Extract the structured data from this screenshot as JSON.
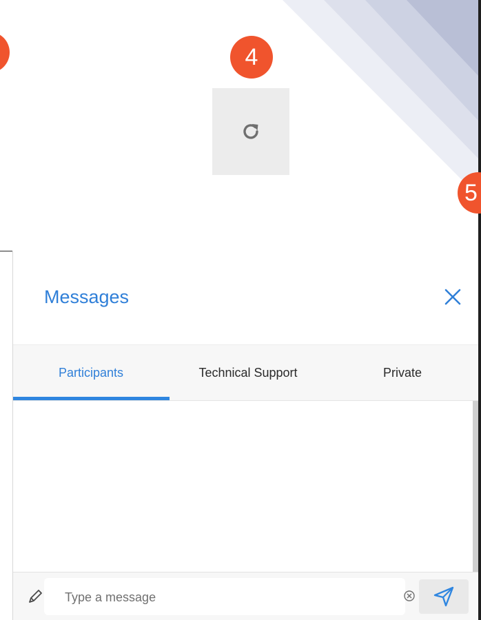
{
  "badges": {
    "left": "",
    "step4": "4",
    "step5": "5"
  },
  "icons": {
    "refresh": "refresh-icon",
    "close": "close-icon",
    "pencil": "pencil-icon",
    "clear": "clear-circle-icon",
    "send": "send-icon"
  },
  "colors": {
    "accent": "#2f7fd8",
    "badge": "#f0542d",
    "deco_light": "#e6e8f1",
    "deco_mid": "#d3d7e6",
    "deco_dark": "#b9bfd6"
  },
  "messages": {
    "title": "Messages",
    "tabs": [
      {
        "label": "Participants",
        "active": true
      },
      {
        "label": "Technical Support",
        "active": false
      },
      {
        "label": "Private",
        "active": false
      }
    ],
    "composer": {
      "value": "",
      "placeholder": "Type a message"
    }
  }
}
